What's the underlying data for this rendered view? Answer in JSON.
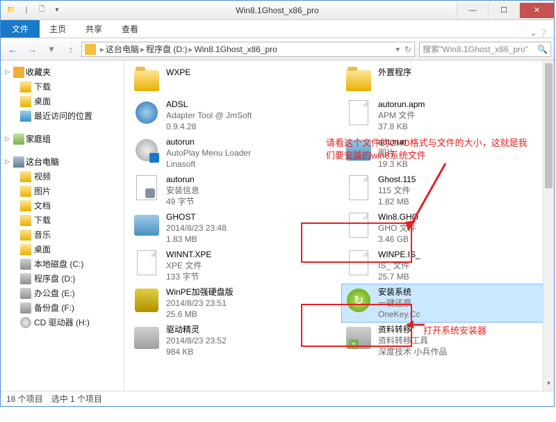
{
  "window": {
    "title": "Win8.1Ghost_x86_pro"
  },
  "ribbon": {
    "file": "文件",
    "tabs": [
      "主页",
      "共享",
      "查看"
    ]
  },
  "breadcrumb": [
    "这台电脑",
    "程序盘 (D:)",
    "Win8.1Ghost_x86_pro"
  ],
  "search_placeholder": "搜索\"Win8.1Ghost_x86_pro\"",
  "sidebar": {
    "favorites": {
      "label": "收藏夹",
      "items": [
        "下载",
        "桌面",
        "最近访问的位置"
      ]
    },
    "homegroup": {
      "label": "家庭组"
    },
    "pc": {
      "label": "这台电脑",
      "items": [
        "视频",
        "图片",
        "文档",
        "下载",
        "音乐",
        "桌面",
        "本地磁盘 (C:)",
        "程序盘 (D:)",
        "办公盘 (E:)",
        "备份盘 (F:)",
        "CD 驱动器 (H:)"
      ]
    }
  },
  "files_left": [
    {
      "name": "WXPE",
      "meta1": "",
      "meta2": "",
      "icon": "folder"
    },
    {
      "name": "ADSL",
      "meta1": "Adapter Tool @ JmSoft",
      "meta2": "0.9.4.28",
      "icon": "globe"
    },
    {
      "name": "autorun",
      "meta1": "AutoPlay Menu Loader",
      "meta2": "Linasoft",
      "icon": "disc"
    },
    {
      "name": "autorun",
      "meta1": "安装信息",
      "meta2": "49 字节",
      "icon": "cfg"
    },
    {
      "name": "GHOST",
      "meta1": "2014/8/23 23:48",
      "meta2": "1.83 MB",
      "icon": "ghost"
    },
    {
      "name": "WINNT.XPE",
      "meta1": "XPE 文件",
      "meta2": "133 字节",
      "icon": "page"
    },
    {
      "name": "WinPE加强硬盘版",
      "meta1": "2014/8/23 23:51",
      "meta2": "25.6 MB",
      "icon": "gear"
    },
    {
      "name": "驱动精灵",
      "meta1": "2014/8/23 23:52",
      "meta2": "984 KB",
      "icon": "gray"
    }
  ],
  "files_right": [
    {
      "name": "外置程序",
      "meta1": "",
      "meta2": "",
      "icon": "folder"
    },
    {
      "name": "autorun.apm",
      "meta1": "APM 文件",
      "meta2": "37.8 KB",
      "icon": "page"
    },
    {
      "name": "autorun",
      "meta1": "图片",
      "meta2": "19.3 KB",
      "icon": "ghost"
    },
    {
      "name": "Ghost.115",
      "meta1": "115 文件",
      "meta2": "1.82 MB",
      "icon": "page"
    },
    {
      "name": "Win8.GHO",
      "meta1": "GHO 文件",
      "meta2": "3.46 GB",
      "icon": "page"
    },
    {
      "name": "WINPE.IS_",
      "meta1": "IS_ 文件",
      "meta2": "25.7 MB",
      "icon": "page"
    },
    {
      "name": "安装系统",
      "meta1": "一键还原",
      "meta2": "OneKey.Cc",
      "icon": "green",
      "selected": true
    },
    {
      "name": "资料转移",
      "meta1": "资料转移工具",
      "meta2": "深度技术 小兵作品",
      "icon": "gray-user"
    }
  ],
  "annotations": {
    "note1": "请看这个文件的GHO格式与文件的大小，这就是我们要安装的win8系统文件",
    "note2": "打开系统安装器"
  },
  "status": {
    "count": "18 个项目",
    "selected": "选中 1 个项目"
  }
}
